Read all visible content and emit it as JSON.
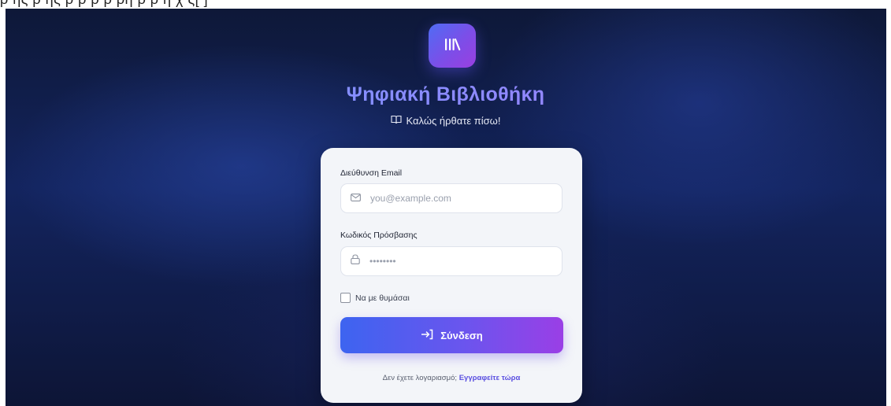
{
  "app": {
    "title": "Ψηφιακή Βιβλιοθήκη",
    "subtitle": "Καλώς ήρθατε πίσω!",
    "accent_start": "#3d64f0",
    "accent_end": "#9a3fe6",
    "logo_icon": "library-icon",
    "subtitle_icon": "open-book-icon"
  },
  "top_strip": {
    "text": "ρ ης ρ ης ρ ρ ρ ρ ρη ρ ρ η χ ς[ ]"
  },
  "login": {
    "email_label": "Διεύθυνση Email",
    "email_placeholder": "you@example.com",
    "email_value": "",
    "email_icon": "mail-icon",
    "password_label": "Κωδικός Πρόσβασης",
    "password_placeholder": "••••••••",
    "password_value": "",
    "password_icon": "lock-icon",
    "remember_label": "Να με θυμάσαι",
    "remember_checked": false,
    "submit_label": "Σύνδεση",
    "submit_icon": "login-arrow-icon",
    "no_account_text": "Δεν έχετε λογαριασμό;",
    "register_link": "Εγγραφείτε τώρα"
  }
}
